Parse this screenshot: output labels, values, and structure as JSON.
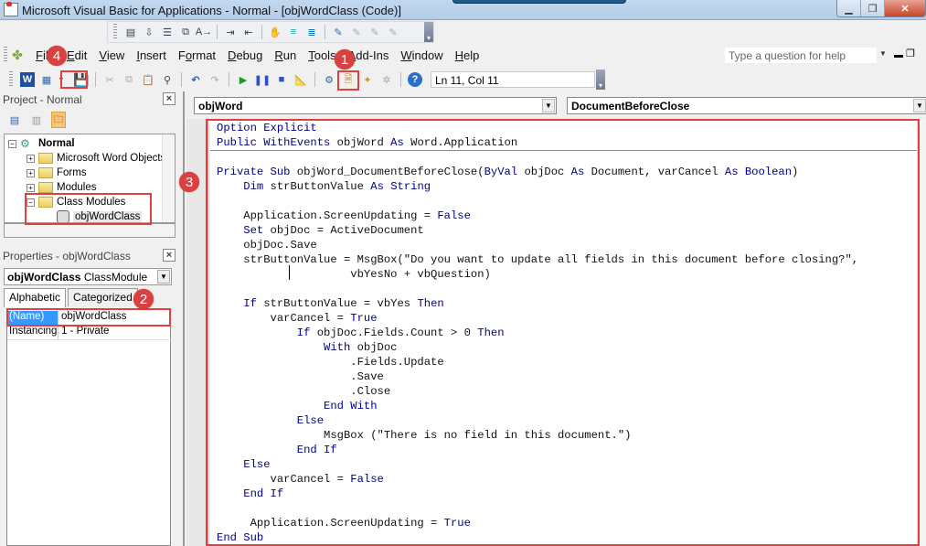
{
  "window": {
    "title": "Microsoft Visual Basic for Applications - Normal - [objWordClass (Code)]",
    "controls": {
      "minimize": "▁",
      "restore": "❐",
      "close": "✕"
    }
  },
  "menu": [
    "File",
    "Edit",
    "View",
    "Insert",
    "Format",
    "Debug",
    "Run",
    "Tools",
    "Add-Ins",
    "Window",
    "Help"
  ],
  "help_box": {
    "placeholder": "Type a question for help"
  },
  "toolbar": {
    "position_readout": "Ln 11, Col 11"
  },
  "callouts": {
    "c1": "1",
    "c2": "2",
    "c3": "3",
    "c4": "4"
  },
  "project_pane": {
    "title": "Project - Normal",
    "tree": [
      {
        "label": "Normal",
        "level": 0,
        "expander": "−",
        "type": "project",
        "bold": true
      },
      {
        "label": "Microsoft Word Objects",
        "level": 1,
        "expander": "+",
        "type": "folder"
      },
      {
        "label": "Forms",
        "level": 1,
        "expander": "+",
        "type": "folder"
      },
      {
        "label": "Modules",
        "level": 1,
        "expander": "+",
        "type": "folder"
      },
      {
        "label": "Class Modules",
        "level": 1,
        "expander": "−",
        "type": "folder-open"
      },
      {
        "label": "objWordClass",
        "level": 2,
        "expander": "",
        "type": "class"
      }
    ]
  },
  "properties_pane": {
    "title": "Properties - objWordClass",
    "object_combo_name": "objWordClass",
    "object_combo_type": "ClassModule",
    "tabs": [
      "Alphabetic",
      "Categorized"
    ],
    "active_tab": "Alphabetic",
    "rows": [
      {
        "name": "(Name)",
        "value": "objWordClass",
        "selected": true
      },
      {
        "name": "Instancing",
        "value": "1 - Private",
        "selected": false
      }
    ]
  },
  "code_window": {
    "object_combo": "objWord",
    "procedure_combo": "DocumentBeforeClose",
    "lines": [
      "<span class=\"kw\">Option Explicit</span>",
      "<span class=\"kw\">Public WithEvents</span> objWord <span class=\"kw\">As</span> Word.Application",
      "",
      "<span class=\"kw\">Private Sub</span> objWord_DocumentBeforeClose(<span class=\"kw\">ByVal</span> objDoc <span class=\"kw\">As</span> Document, varCancel <span class=\"kw\">As Boolean</span>)",
      "    <span class=\"kw\">Dim</span> strButtonValue <span class=\"kw\">As String</span>",
      "",
      "    Application.ScreenUpdating = <span class=\"kw\">False</span>",
      "    <span class=\"kw\">Set</span> objDoc = ActiveDocument",
      "    objDoc.Save",
      "    strButtonValue = MsgBox(\"Do you want to update all fields in this document before closing?\",",
      "                    vbYesNo + vbQuestion)",
      "",
      "    <span class=\"kw\">If</span> strButtonValue = vbYes <span class=\"kw\">Then</span>",
      "        varCancel = <span class=\"kw\">True</span>",
      "            <span class=\"kw\">If</span> objDoc.Fields.Count &gt; 0 <span class=\"kw\">Then</span>",
      "                <span class=\"kw\">With</span> objDoc",
      "                    .Fields.Update",
      "                    .Save",
      "                    .Close",
      "                <span class=\"kw\">End With</span>",
      "            <span class=\"kw\">Else</span>",
      "                MsgBox (\"There is no field in this document.\")",
      "            <span class=\"kw\">End If</span>",
      "    <span class=\"kw\">Else</span>",
      "        varCancel = <span class=\"kw\">False</span>",
      "    <span class=\"kw\">End If</span>",
      "",
      "     Application.ScreenUpdating = <span class=\"kw\">True</span>",
      "<span class=\"kw\">End Sub</span>"
    ]
  },
  "colors": {
    "callout": "#d94040",
    "highlight_box": "#e04040",
    "keyword": "#00008b",
    "selection": "#3399ff"
  }
}
